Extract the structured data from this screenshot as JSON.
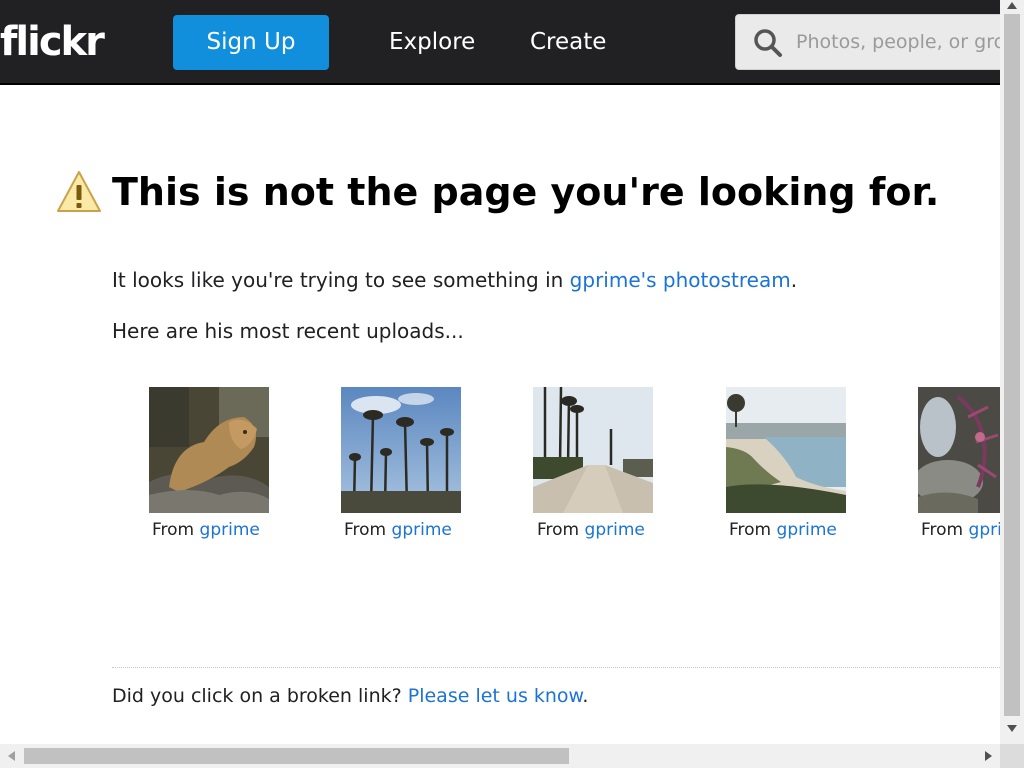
{
  "header": {
    "logo": "flickr",
    "signup_label": "Sign Up",
    "nav": [
      "Explore",
      "Create"
    ],
    "search_placeholder": "Photos, people, or groups"
  },
  "main": {
    "headline": "This is not the page you're looking for.",
    "line1_prefix": "It looks like you're trying to see something in ",
    "line1_link": "gprime's photostream",
    "line1_suffix": ".",
    "line2": "Here are his most recent uploads...",
    "uploads": [
      {
        "from": "From",
        "user": "gprime",
        "subject": "lioness"
      },
      {
        "from": "From",
        "user": "gprime",
        "subject": "palm trees"
      },
      {
        "from": "From",
        "user": "gprime",
        "subject": "boardwalk"
      },
      {
        "from": "From",
        "user": "gprime",
        "subject": "coastline"
      },
      {
        "from": "From",
        "user": "gprime",
        "subject": "leafy seadragon"
      }
    ]
  },
  "footer": {
    "text": "Did you click on a broken link? ",
    "link": "Please let us know",
    "suffix": "."
  },
  "colors": {
    "topbar": "#212124",
    "signup": "#128fdc",
    "link": "#1a73d6"
  }
}
